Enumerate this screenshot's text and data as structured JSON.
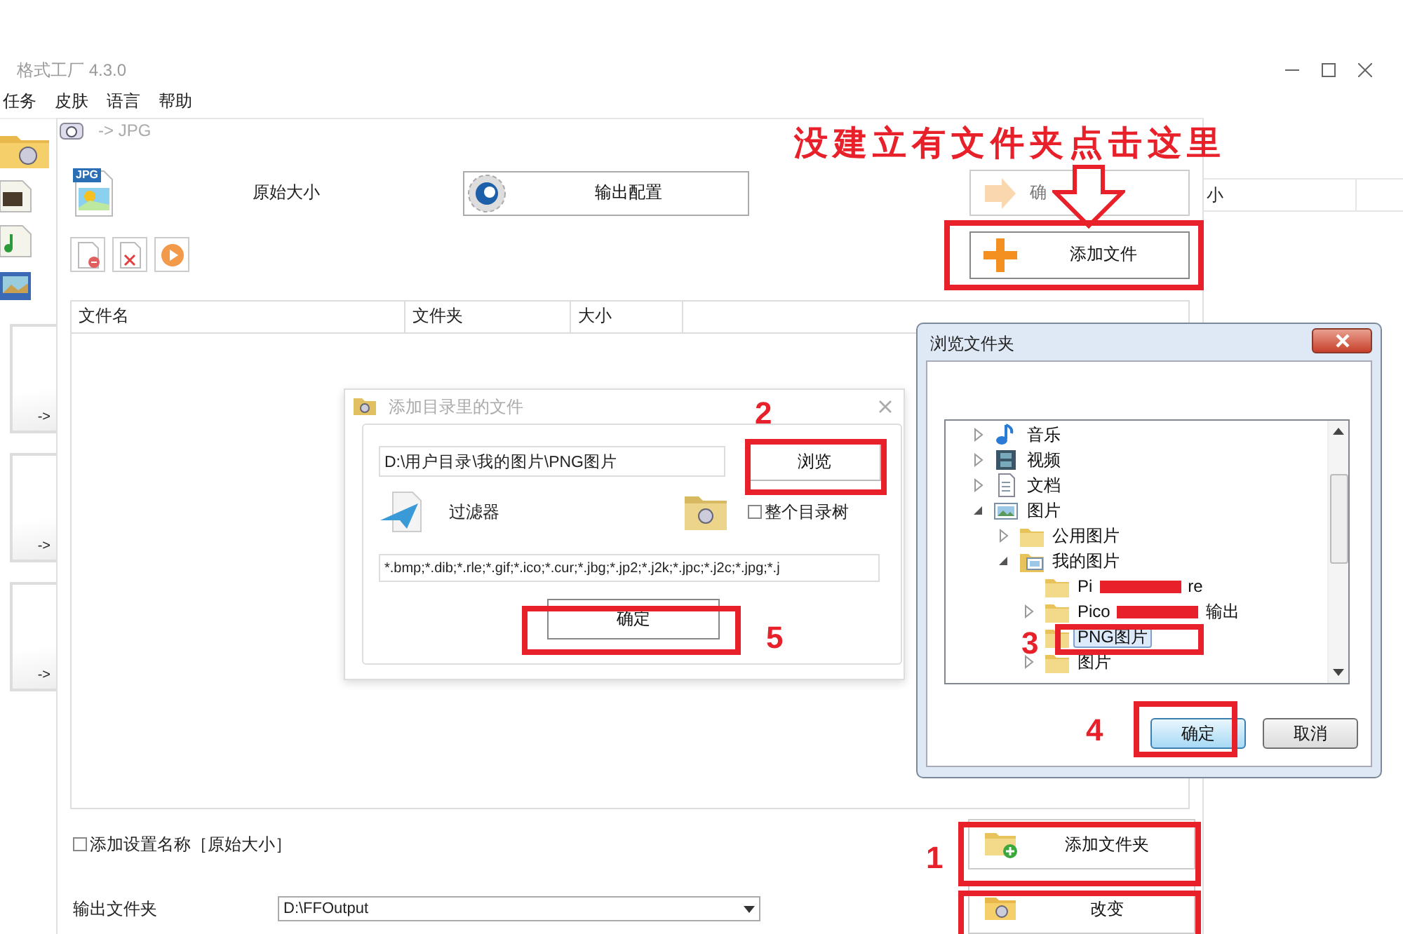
{
  "app": {
    "title": "格式工厂 4.3.0",
    "menu": [
      {
        "label": "任务"
      },
      {
        "label": "皮肤"
      },
      {
        "label": "语言"
      },
      {
        "label": "帮助"
      }
    ]
  },
  "sidebar": {
    "cards": [
      {
        "label": "->"
      },
      {
        "label": "->"
      },
      {
        "label": "->"
      }
    ]
  },
  "background_panel": {
    "column_header": "小"
  },
  "convert_dialog": {
    "title": "-> JPG",
    "preset_badge": "JPG",
    "preset": "原始大小",
    "output_config_button": "输出配置",
    "ok_button": {
      "label": "确",
      "disabled": true
    },
    "add_file_button": "添加文件",
    "table": {
      "columns": [
        "文件名",
        "文件夹",
        "大小"
      ]
    },
    "add_setting_name": {
      "label": "添加设置名称［原始大小］",
      "checked": false
    },
    "output_folder": {
      "label": "输出文件夹",
      "value": "D:\\FFOutput"
    },
    "add_folder_button": "添加文件夹",
    "change_button": "改变"
  },
  "add_dir_dialog": {
    "title": "添加目录里的文件",
    "path": "D:\\用户目录\\我的图片\\PNG图片",
    "browse_button": "浏览",
    "filter_label": "过滤器",
    "whole_tree": {
      "label": "整个目录树",
      "checked": false
    },
    "filter": "*.bmp;*.dib;*.rle;*.gif;*.ico;*.cur;*.jbg;*.jp2;*.j2k;*.jpc;*.j2c;*.jpg;*.j",
    "ok_button": "确定"
  },
  "browse_dialog": {
    "title": "浏览文件夹",
    "tree": [
      {
        "label": "音乐",
        "kind": "music",
        "expanded": false,
        "selected": false
      },
      {
        "label": "视频",
        "kind": "video",
        "expanded": false,
        "selected": false
      },
      {
        "label": "文档",
        "kind": "document",
        "expanded": false,
        "selected": false
      },
      {
        "label": "图片",
        "kind": "pictures",
        "expanded": true,
        "selected": false,
        "children": [
          {
            "label": "公用图片",
            "kind": "folder",
            "expanded": false,
            "selected": false
          },
          {
            "label": "我的图片",
            "kind": "picture-folder",
            "expanded": true,
            "selected": false,
            "children": [
              {
                "label": "Pi",
                "label_end": "re",
                "kind": "leaf",
                "redacted": true,
                "selected": false
              },
              {
                "label": "Pico",
                "label_end": "输出",
                "kind": "folder",
                "redacted": true,
                "expanded": false,
                "selected": false
              },
              {
                "label": "PNG图片",
                "kind": "leaf",
                "selected": true
              },
              {
                "label": "图片",
                "kind": "folder",
                "expanded": false,
                "selected": false
              }
            ]
          }
        ]
      }
    ],
    "ok_button": "确定",
    "cancel_button": "取消"
  },
  "annotations": {
    "callout": "没建立有文件夹点击这里",
    "steps": [
      "1",
      "2",
      "3",
      "4",
      "5"
    ]
  }
}
